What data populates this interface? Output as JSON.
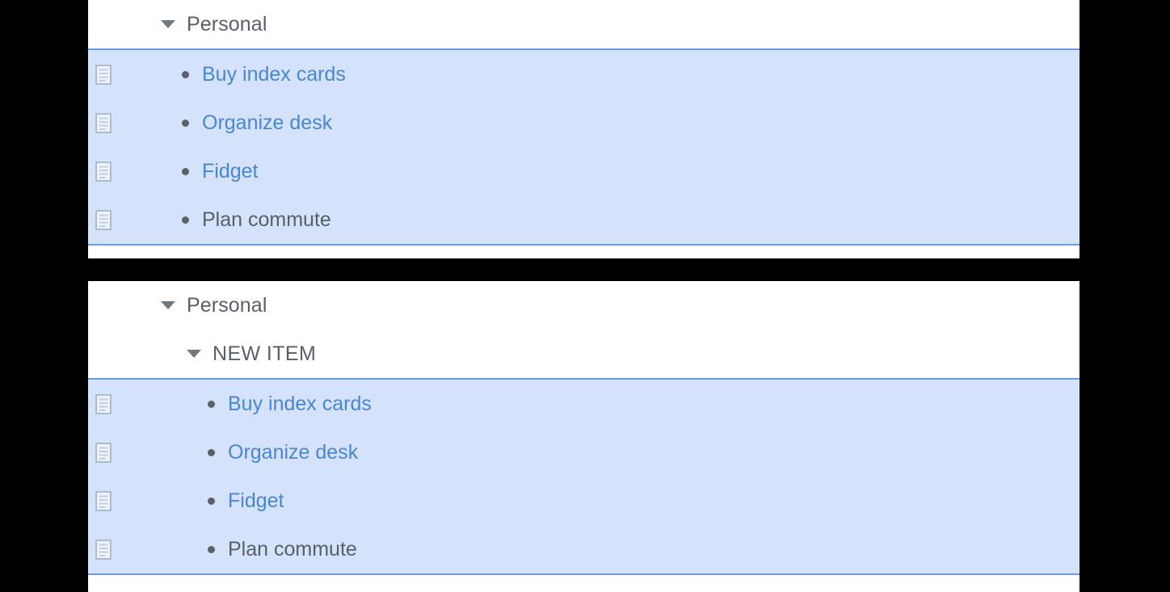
{
  "panels": [
    {
      "name": "before",
      "group": {
        "label": "Personal",
        "disclosure": "expanded"
      },
      "items": [
        {
          "label": "Buy index cards",
          "style": "link",
          "icon": "note-icon"
        },
        {
          "label": "Organize desk",
          "style": "link",
          "icon": "note-icon"
        },
        {
          "label": "Fidget",
          "style": "link",
          "icon": "note-icon"
        },
        {
          "label": "Plan commute",
          "style": "plain",
          "icon": "note-icon"
        }
      ]
    },
    {
      "name": "after",
      "group": {
        "label": "Personal",
        "disclosure": "expanded"
      },
      "subgroup": {
        "label": "NEW ITEM",
        "disclosure": "expanded"
      },
      "items": [
        {
          "label": "Buy index cards",
          "style": "link",
          "icon": "note-icon"
        },
        {
          "label": "Organize desk",
          "style": "link",
          "icon": "note-icon"
        },
        {
          "label": "Fidget",
          "style": "link",
          "icon": "note-icon"
        },
        {
          "label": "Plan commute",
          "style": "plain",
          "icon": "note-icon"
        }
      ]
    }
  ],
  "colors": {
    "selection_background": "#d4e3fb",
    "selection_border": "#6b9ae4",
    "link_text": "#4a86d3",
    "plain_text": "#595f66",
    "heading_text": "#585f66",
    "panel_background": "#ffffff",
    "page_background": "#000000",
    "icon_outline": "#aebbcb"
  }
}
